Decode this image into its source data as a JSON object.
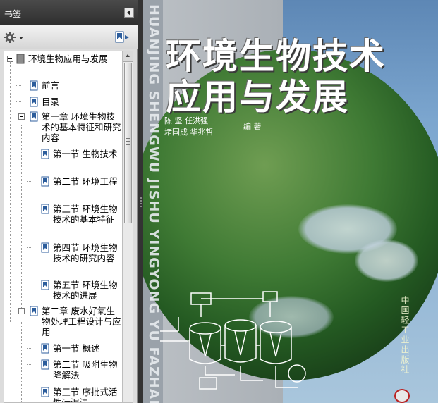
{
  "panel": {
    "title": "书签",
    "collapse_icon": "triangle-left-icon",
    "options_icon": "gear-icon",
    "new_bookmark_icon": "new-bookmark-icon"
  },
  "bookmarks": [
    {
      "label": "环境生物应用与发展",
      "level": 0,
      "expanded": true
    },
    {
      "label": "前言",
      "level": 1
    },
    {
      "label": "目录",
      "level": 1
    },
    {
      "label": "第一章 环境生物技术的基本特征和研究内容",
      "level": 1,
      "expanded": true
    },
    {
      "label": "第一节 生物技术",
      "level": 2
    },
    {
      "label": "第二节 环境工程",
      "level": 2
    },
    {
      "label": "第三节 环境生物技术的基本特征",
      "level": 2
    },
    {
      "label": "第四节 环境生物技术的研究内容",
      "level": 2
    },
    {
      "label": "第五节 环境生物技术的进展",
      "level": 2
    },
    {
      "label": "第二章 废水好氧生物处理工程设计与应用",
      "level": 1,
      "expanded": true
    },
    {
      "label": "第一节 概述",
      "level": 2
    },
    {
      "label": "第二节 吸附生物降解法",
      "level": 2
    },
    {
      "label": "第三节 序批式活性污泥法",
      "level": 2
    }
  ],
  "cover": {
    "spine_text": "HUANJING SHENGWU JISHU YINGYONG YU FAZHAN",
    "title_line1": "环境生物技术",
    "title_line2": "应用与发展",
    "editors_line1": "陈 坚 任洪强",
    "editors_line2": "堵国成 华兆哲",
    "editor_role": "编 著",
    "publisher": "中国轻工业出版社",
    "colors": {
      "band": "#aab0b6",
      "sky": "#7ca6cf",
      "globe": "#3f7a34"
    }
  }
}
